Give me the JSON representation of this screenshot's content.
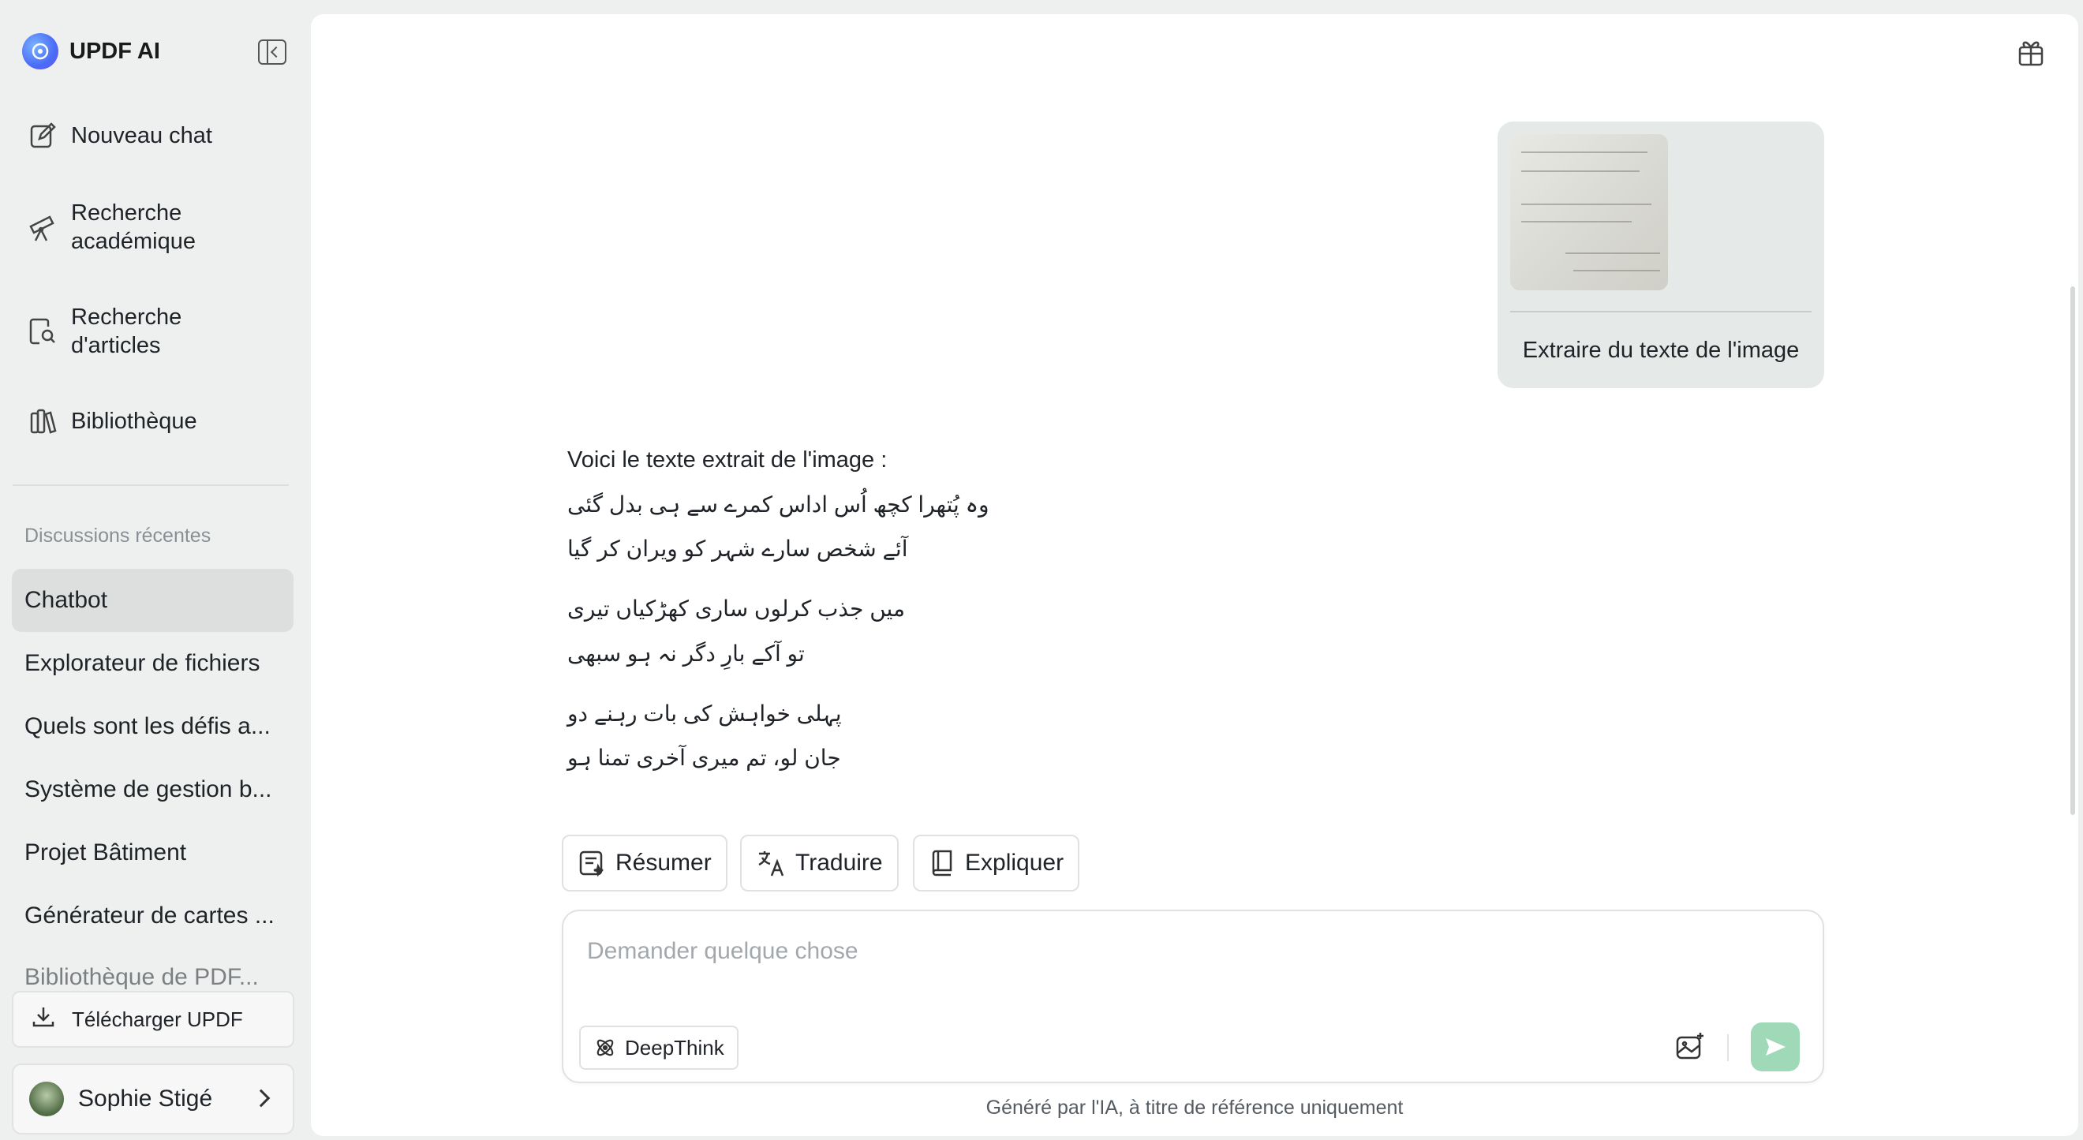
{
  "app": {
    "name": "UPDF AI"
  },
  "sidebar": {
    "nav": [
      {
        "label": "Nouveau chat",
        "icon": "new-chat-icon"
      },
      {
        "label": "Recherche académique",
        "icon": "telescope-icon"
      },
      {
        "label": "Recherche d'articles",
        "icon": "article-search-icon"
      },
      {
        "label": "Bibliothèque",
        "icon": "library-icon"
      }
    ],
    "recent_label": "Discussions récentes",
    "recent": [
      "Chatbot",
      "Explorateur de fichiers",
      "Quels sont les défis a...",
      "Système de gestion b...",
      "Projet Bâtiment",
      "Générateur de cartes ...",
      "Bibliothèque de PDF..."
    ],
    "download_label": "Télécharger UPDF",
    "user_name": "Sophie Stigé"
  },
  "conversation": {
    "user_message": "Extraire du texte de l'image",
    "answer_intro": "Voici le texte extrait de l'image :",
    "poem_lines": [
      "وہ پُتھرا کچھ اُس اداس کمرے سے ہی بدل گئی",
      "آئے شخص سارے شہر کو ویران کر گیا",
      "میں جذب کرلوں ساری کھڑکیاں تیری",
      "تو آکے بارِ دگر نہ ہو سبھی",
      "پہلی خواہش کی بات رہنے دو",
      "جان لو، تم میری آخری تمنا ہو"
    ]
  },
  "actions": [
    {
      "label": "Résumer",
      "icon": "summarize-icon"
    },
    {
      "label": "Traduire",
      "icon": "translate-icon"
    },
    {
      "label": "Expliquer",
      "icon": "book-icon"
    }
  ],
  "composer": {
    "placeholder": "Demander quelque chose",
    "value": "",
    "deepthink_label": "DeepThink"
  },
  "footer_note": "Généré par l'IA, à titre de référence uniquement",
  "colors": {
    "send_button": "#9fd9b7",
    "sidebar_bg": "#eef0ef",
    "active_item": "#dcdfdd"
  }
}
